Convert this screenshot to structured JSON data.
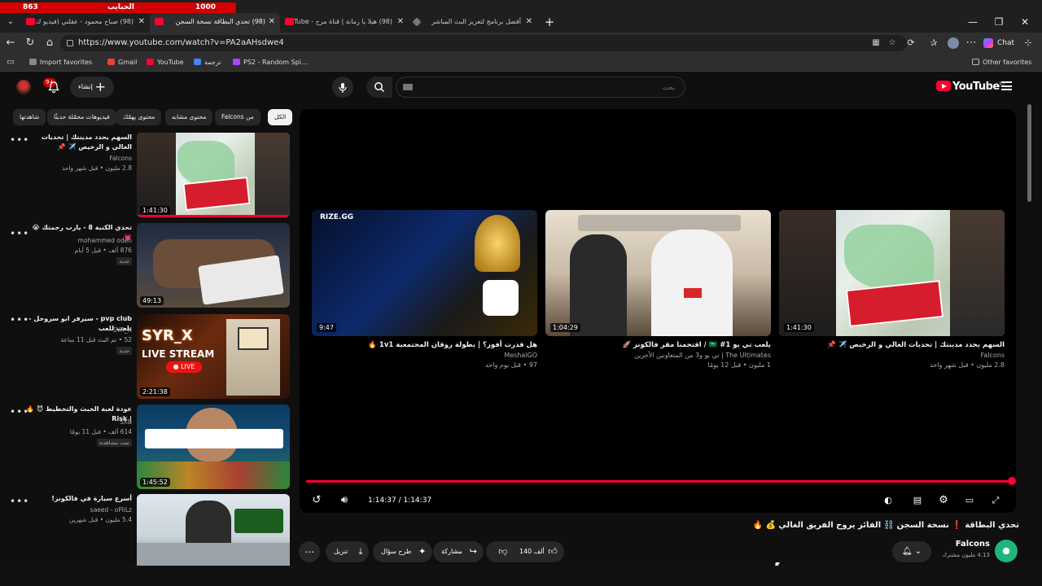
{
  "score_bar": {
    "left_score": "863",
    "center_label": "الحبايب",
    "right_score": "1000"
  },
  "tabs": [
    {
      "label": "(98) صباح محمود - عقلني (فيديو ك...",
      "active": false
    },
    {
      "label": "نسخة السجن",
      "active": true
    },
    {
      "label": "(98) تحدي البطاقة",
      "active": true
    },
    {
      "label": "(98) هيلا يا رمانة | قناة مرح - Tube",
      "active": false
    },
    {
      "label": "أفضل برنامج لتعزيز البث المباشر",
      "active": false
    }
  ],
  "address": {
    "url": "https://www.youtube.com/watch?v=PA2aAHsdwe4"
  },
  "browser": {
    "chat_label": "Chat"
  },
  "bookmarks": [
    {
      "label": "Import favorites",
      "color": "#888888"
    },
    {
      "label": "Gmail",
      "color": "#ea4335"
    },
    {
      "label": "YouTube",
      "color": "#ff0033"
    },
    {
      "label": "ترجمة",
      "color": "#4285f4"
    },
    {
      "label": "PS2 - Random Spi...",
      "color": "#b043ff"
    }
  ],
  "other_favorites": "Other favorites",
  "masthead": {
    "logo": "YouTube",
    "logo_region": "JO",
    "search_placeholder": "بحث",
    "create_label": "إنشاء",
    "notif_count": "9+"
  },
  "chips": [
    "الكل",
    "من Falcons",
    "محتوى يهمّك",
    "محتوى مشابه",
    "فيديوهات محمّلة حديثًا",
    "شاهدتها"
  ],
  "recommendations": [
    {
      "title": "السهم يحدد مدينتك | تحديات الغالي و الرخيص ✈️ 📌",
      "channel": "Falcons",
      "meta": "2.8 مليون • قبل شهر واحد",
      "duration": "1:41:30",
      "badge": "",
      "verified": true
    },
    {
      "title": "تحدي الكنبة 8 - يارب رحمتك 😭 💗",
      "channel": "mohammed oden",
      "meta": "876 ألف • قبل 5 أيام",
      "duration": "49:13",
      "badge": "جديد",
      "verified": true
    },
    {
      "title": "pvp club - سيرفر ابو سروحل - تلعب للعب",
      "channel": "SYR_X",
      "meta": "52 • تم البث قبل 11 ساعة",
      "duration": "2:21:38",
      "badge": "جديد",
      "verified": false
    },
    {
      "title": "عودة لعبة الخبث والتخطيط 😈 🔥 | Risk",
      "channel": "SXB",
      "meta": "614 ألف • قبل 11 يومًا",
      "duration": "1:45:52",
      "badge": "تمت مشاهدته",
      "verified": false
    },
    {
      "title": "أسرع سيارة في فالكونز!",
      "channel": "saeed - oPiiLz",
      "meta": "5.4 مليون • قبل شهرين",
      "duration": "",
      "badge": "",
      "verified": true
    }
  ],
  "endscreen": [
    {
      "title": "هل قدرت أفوز؟ | بطولة روقان المجتمعية 1v1 🔥",
      "channel": "MeshalGO",
      "meta": "97 • قبل يوم واحد",
      "duration": "9:47"
    },
    {
      "title": "يلعب تي يو 🇸🇦 #1 / اقتحمنا مقر فالكونز 🚀",
      "channel": "The Ultimates | تي يو و3 من المتعاونين الأخرين",
      "meta": "1 مليون • قبل 12 يومًا",
      "duration": "1:04:29"
    },
    {
      "title": "السهم يحدد مدينتك | تحديات الغالي و الرخيص ✈️ 📌",
      "channel": "Falcons",
      "meta": "2.8 مليون • قبل شهر واحد",
      "duration": "1:41:30"
    }
  ],
  "player": {
    "time": "1:14:37 / 1:14:37",
    "progress": 1.0
  },
  "video": {
    "title": "تحدي البطاقة ❗ نسخة السجن ⛓️ الفائز يروح الفريق الغالي 💰 🔥",
    "channel": "Falcons",
    "subscribers": "4.13 مليون مشترك",
    "likes": "140 ألف",
    "share_label": "مشاركة",
    "ask_label": "طرح سؤال",
    "download_label": "تنزيل"
  }
}
